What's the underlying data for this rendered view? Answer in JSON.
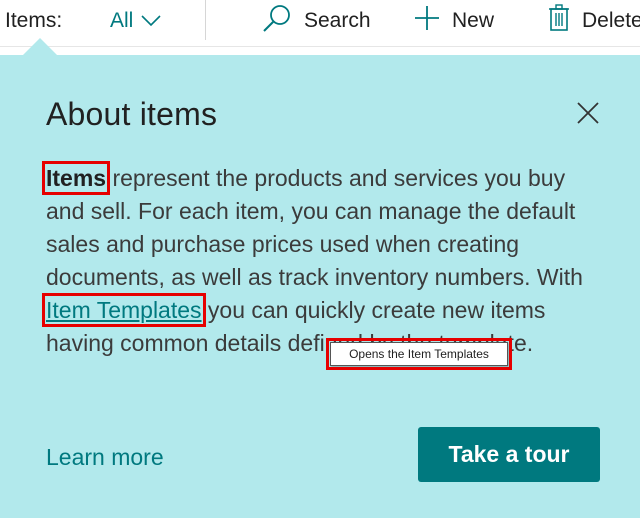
{
  "commandbar": {
    "title": "Items:",
    "filter_label": "All",
    "search_label": "Search",
    "new_label": "New",
    "delete_label": "Delete",
    "icons": {
      "filter": "chevron-down-icon",
      "search": "search-icon",
      "new": "plus-icon",
      "delete": "trash-icon"
    }
  },
  "teaching_bubble": {
    "title": "About items",
    "close_icon": "close-icon",
    "body": {
      "term": "Items",
      "text_1": " represent the products and services you buy and sell. For each item, you can manage the default sales and purchase prices used when creating documents, as well as track inventory numbers. With ",
      "link": "Item Templates",
      "text_2": " you can quickly create new items having common details defined by the template."
    },
    "tooltip": "Opens the Item Templates",
    "learn_more": "Learn more",
    "tour_button": "Take a tour"
  },
  "colors": {
    "accent": "#00797f",
    "bubble_bg": "#b2e9ec",
    "highlight": "#e60000"
  }
}
